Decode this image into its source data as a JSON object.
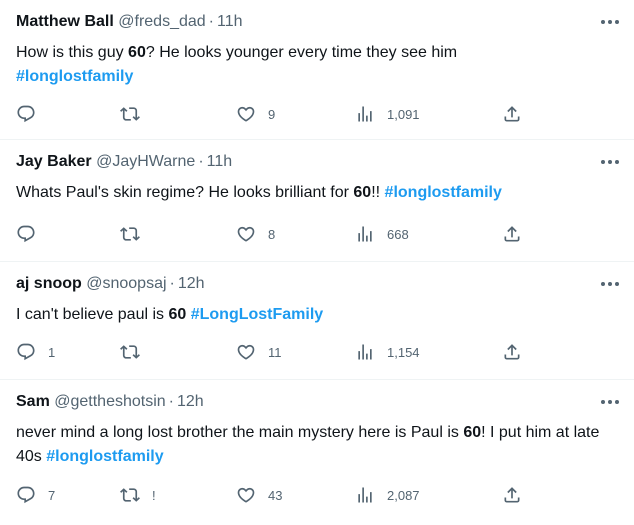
{
  "tweets": [
    {
      "name": "Matthew Ball",
      "handle": "@freds_dad",
      "dot": "·",
      "time": "11h",
      "text": [
        "How is this guy ",
        "60",
        "?  He looks younger every time they see him",
        "#longlostfamily"
      ],
      "replies": "",
      "retweets": "",
      "likes": "9",
      "views": "1,091"
    },
    {
      "name": "Jay Baker",
      "handle": "@JayHWarne",
      "dot": "·",
      "time": "11h",
      "text": [
        "Whats Paul's skin regime? He looks brilliant for ",
        "60",
        "!! ",
        "#longlostfamily"
      ],
      "replies": "",
      "retweets": "",
      "likes": "8",
      "views": "668"
    },
    {
      "name": "aj snoop",
      "handle": "@snoopsaj",
      "dot": "·",
      "time": "12h",
      "text": [
        "I can't believe paul is ",
        "60",
        " ",
        "#LongLostFamily"
      ],
      "replies": "1",
      "retweets": "",
      "likes": "11",
      "views": "1,154"
    },
    {
      "name": "Sam",
      "handle": "@gettheshotsin",
      "dot": "·",
      "time": "12h",
      "text": [
        "never mind a long lost brother the main mystery here is Paul is ",
        "60",
        "! I put him at late 40s  ",
        "#longlostfamily"
      ],
      "replies": "7",
      "retweets": "!",
      "likes": "43",
      "views": "2,087"
    }
  ],
  "icons": {
    "more": "more-horizontal-icon",
    "reply": "reply-icon",
    "retweet": "retweet-icon",
    "like": "heart-icon",
    "views": "views-chart-icon",
    "share": "share-icon"
  },
  "colors": {
    "text": "#0f1419",
    "secondary": "#536471",
    "hashtag": "#1d9bf0",
    "divider": "#eff3f4"
  }
}
